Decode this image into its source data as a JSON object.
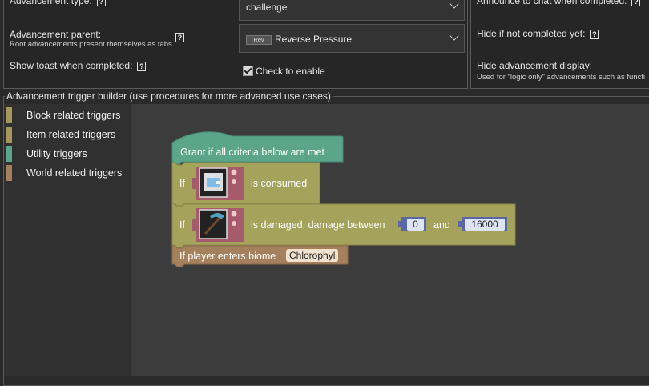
{
  "form": {
    "advancement_type": {
      "label": "Advancement type:",
      "value": "challenge"
    },
    "advancement_parent": {
      "label": "Advancement parent:",
      "hint": "Root advancements present themselves as tabs",
      "value": "Reverse Pressure",
      "icon_text": "Rev"
    },
    "show_toast": {
      "label": "Show toast when completed:",
      "checkbox_label": "Check to enable",
      "checked": true
    },
    "announce_chat": {
      "label": "Announce to chat when completed:"
    },
    "hide_if_not_completed": {
      "label": "Hide if not completed yet:"
    },
    "hide_display": {
      "label": "Hide advancement display:",
      "hint": "Used for \"logic only\" advancements such as functi"
    },
    "help_glyph": "?"
  },
  "builder": {
    "title": "Advancement trigger builder (use procedures for more advanced use cases)",
    "categories": [
      {
        "label": "Block related triggers",
        "color": "#a5985c"
      },
      {
        "label": "Item related triggers",
        "color": "#a5985c"
      },
      {
        "label": "Utility triggers",
        "color": "#5ba58b"
      },
      {
        "label": "World related triggers",
        "color": "#a5805c"
      }
    ],
    "blocks": {
      "grant": {
        "label": "Grant if all criteria below are met",
        "color": "#5ba58b"
      },
      "consumed": {
        "if": "If",
        "text": "is consumed",
        "color": "#a5a25c"
      },
      "damaged": {
        "if": "If",
        "text": "is damaged, damage between",
        "min": "0",
        "and": "and",
        "max": "16000",
        "color": "#a5a25c"
      },
      "biome": {
        "text": "If player enters biome",
        "value": "Chlorophyl",
        "color": "#a5805c"
      },
      "item_color": "#a55b6b",
      "number_color": "#5b67a5"
    }
  }
}
